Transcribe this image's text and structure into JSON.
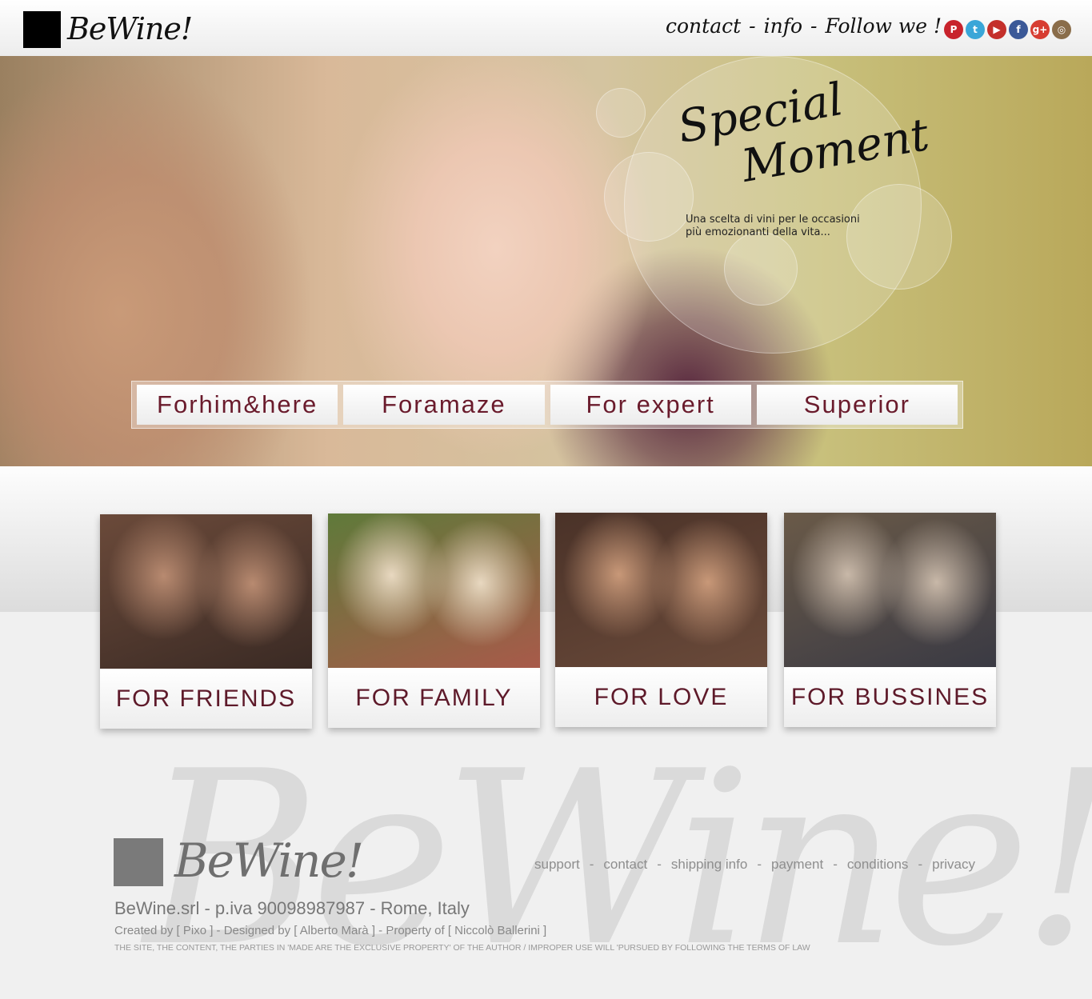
{
  "header": {
    "logo_text": "BeWine!",
    "nav": [
      "contact",
      "info",
      "Follow we !"
    ],
    "nav_separator": "-",
    "social": [
      {
        "icon": "pinterest-icon",
        "glyph": "P",
        "color": "#c8232c"
      },
      {
        "icon": "twitter-icon",
        "glyph": "t",
        "color": "#3aa6d8"
      },
      {
        "icon": "youtube-icon",
        "glyph": "▶",
        "color": "#c4302b"
      },
      {
        "icon": "facebook-icon",
        "glyph": "f",
        "color": "#3b5998"
      },
      {
        "icon": "google-plus-icon",
        "glyph": "g+",
        "color": "#d73d32"
      },
      {
        "icon": "instagram-icon",
        "glyph": "◎",
        "color": "#8a6d4a"
      }
    ]
  },
  "hero": {
    "title_line1": "Special",
    "title_line2": "Moment",
    "subtitle_line1": "Una scelta di vini per le occasioni",
    "subtitle_line2": "più emozionanti della vita...",
    "tabs": [
      "Forhim&here",
      "Foramaze",
      "For expert",
      "Superior"
    ]
  },
  "cards": [
    {
      "label": "FOR FRIENDS",
      "colors": [
        "#6b4a3a",
        "#b88a70",
        "#3a2a24"
      ]
    },
    {
      "label": "FOR FAMILY",
      "colors": [
        "#5f7a3a",
        "#e8d8c0",
        "#a85a4a"
      ]
    },
    {
      "label": "FOR LOVE",
      "colors": [
        "#4a3228",
        "#c89878",
        "#6a4a3a"
      ]
    },
    {
      "label": "FOR BUSSINES",
      "colors": [
        "#6a5a48",
        "#c8b8a8",
        "#3a3a44"
      ]
    }
  ],
  "footer": {
    "logo_text": "BeWine!",
    "watermark": "BeWine!",
    "links": [
      "support",
      "contact",
      "shipping info",
      "payment",
      "conditions",
      "privacy"
    ],
    "company": "BeWine.srl - p.iva 90098987987 - Rome, Italy",
    "credits": "Created by [ Pixo ] - Designed by [ Alberto Marà ] - Property of  [ Niccolò Ballerini ]",
    "legal": "THE SITE, THE CONTENT, THE PARTIES IN 'MADE ARE THE EXCLUSIVE PROPERTY' OF THE AUTHOR / IMPROPER USE WILL 'PURSUED BY FOLLOWING THE TERMS OF LAW"
  }
}
